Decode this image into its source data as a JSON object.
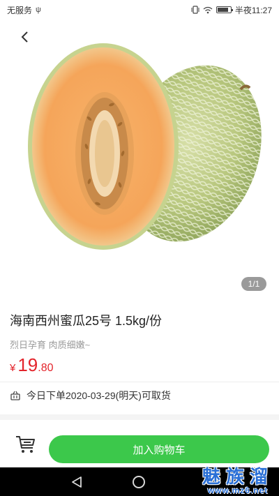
{
  "status_bar": {
    "carrier": "无服务",
    "usb_glyph": "ψ",
    "time_label": "半夜11:27",
    "icons": [
      "vibrate-icon",
      "wifi-icon",
      "battery-icon"
    ]
  },
  "product": {
    "image_counter": "1/1",
    "title": "海南西州蜜瓜25号 1.5kg/份",
    "subtitle": "烈日孕育 肉质细嫩~",
    "price": {
      "currency": "¥",
      "integer": "19",
      "decimal": ".80"
    },
    "pickup_text": "今日下单2020-03-29(明天)可取货"
  },
  "bottom_bar": {
    "add_to_cart_label": "加入购物车"
  },
  "watermark": {
    "title": "魅族溜",
    "url": "www.mz6.net"
  },
  "colors": {
    "accent_green": "#3cc84b",
    "price_red": "#e3242b",
    "watermark_blue": "#2a6fd6"
  }
}
